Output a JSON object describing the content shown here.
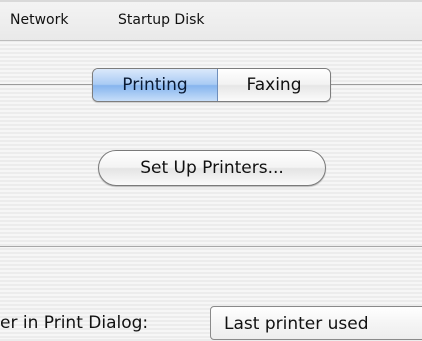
{
  "toolbar": {
    "items": [
      {
        "label": "Network"
      },
      {
        "label": "Startup Disk"
      }
    ]
  },
  "tabs": {
    "options": [
      {
        "label": "Printing",
        "selected": true
      },
      {
        "label": "Faxing",
        "selected": false
      }
    ]
  },
  "main": {
    "setup_button_label": "Set Up Printers..."
  },
  "selected_printer": {
    "label": "er in Print Dialog:",
    "value": "Last printer used"
  },
  "colors": {
    "accent": "#86b5ee",
    "background": "#ececec"
  }
}
